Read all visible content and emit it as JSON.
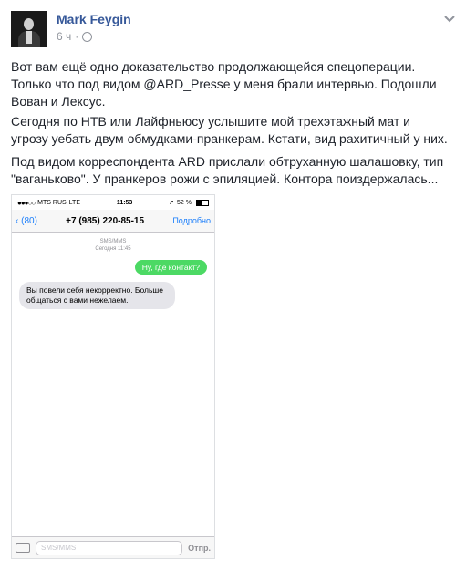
{
  "post": {
    "author": "Mark Feygin",
    "time": "6 ч",
    "paragraphs": [
      "Вот вам ещё одно доказательство продолжающейся спецоперации. Только что под видом @ARD_Presse у меня брали интервью. Подошли Вован и Лексус.",
      "Сегодня по НТВ или Лайфньюсу услышите мой трехэтажный мат и угрозу уебать двум обмудками-пранкерам. Кстати, вид рахитичный у них.",
      "Под видом корреспондента ARD прислали обтруханную шалашовку, тип \"ваганьково\". У пранкеров рожи с эпиляцией. Контора поиздержалась..."
    ]
  },
  "phone": {
    "carrier": "MTS RUS",
    "network": "LTE",
    "clock": "11:53",
    "battery": "52 %",
    "back_label": "(80)",
    "contact": "+7 (985) 220-85-15",
    "details_label": "Подробно",
    "service_label": "SMS/MMS",
    "date_label": "Сегодня 11:45",
    "messages": {
      "outgoing": "Ну, где контакт?",
      "incoming": "Вы повели себя некорректно. Больше общаться с вами нежелаем."
    },
    "compose_placeholder": "SMS/MMS",
    "send_label": "Отпр."
  }
}
